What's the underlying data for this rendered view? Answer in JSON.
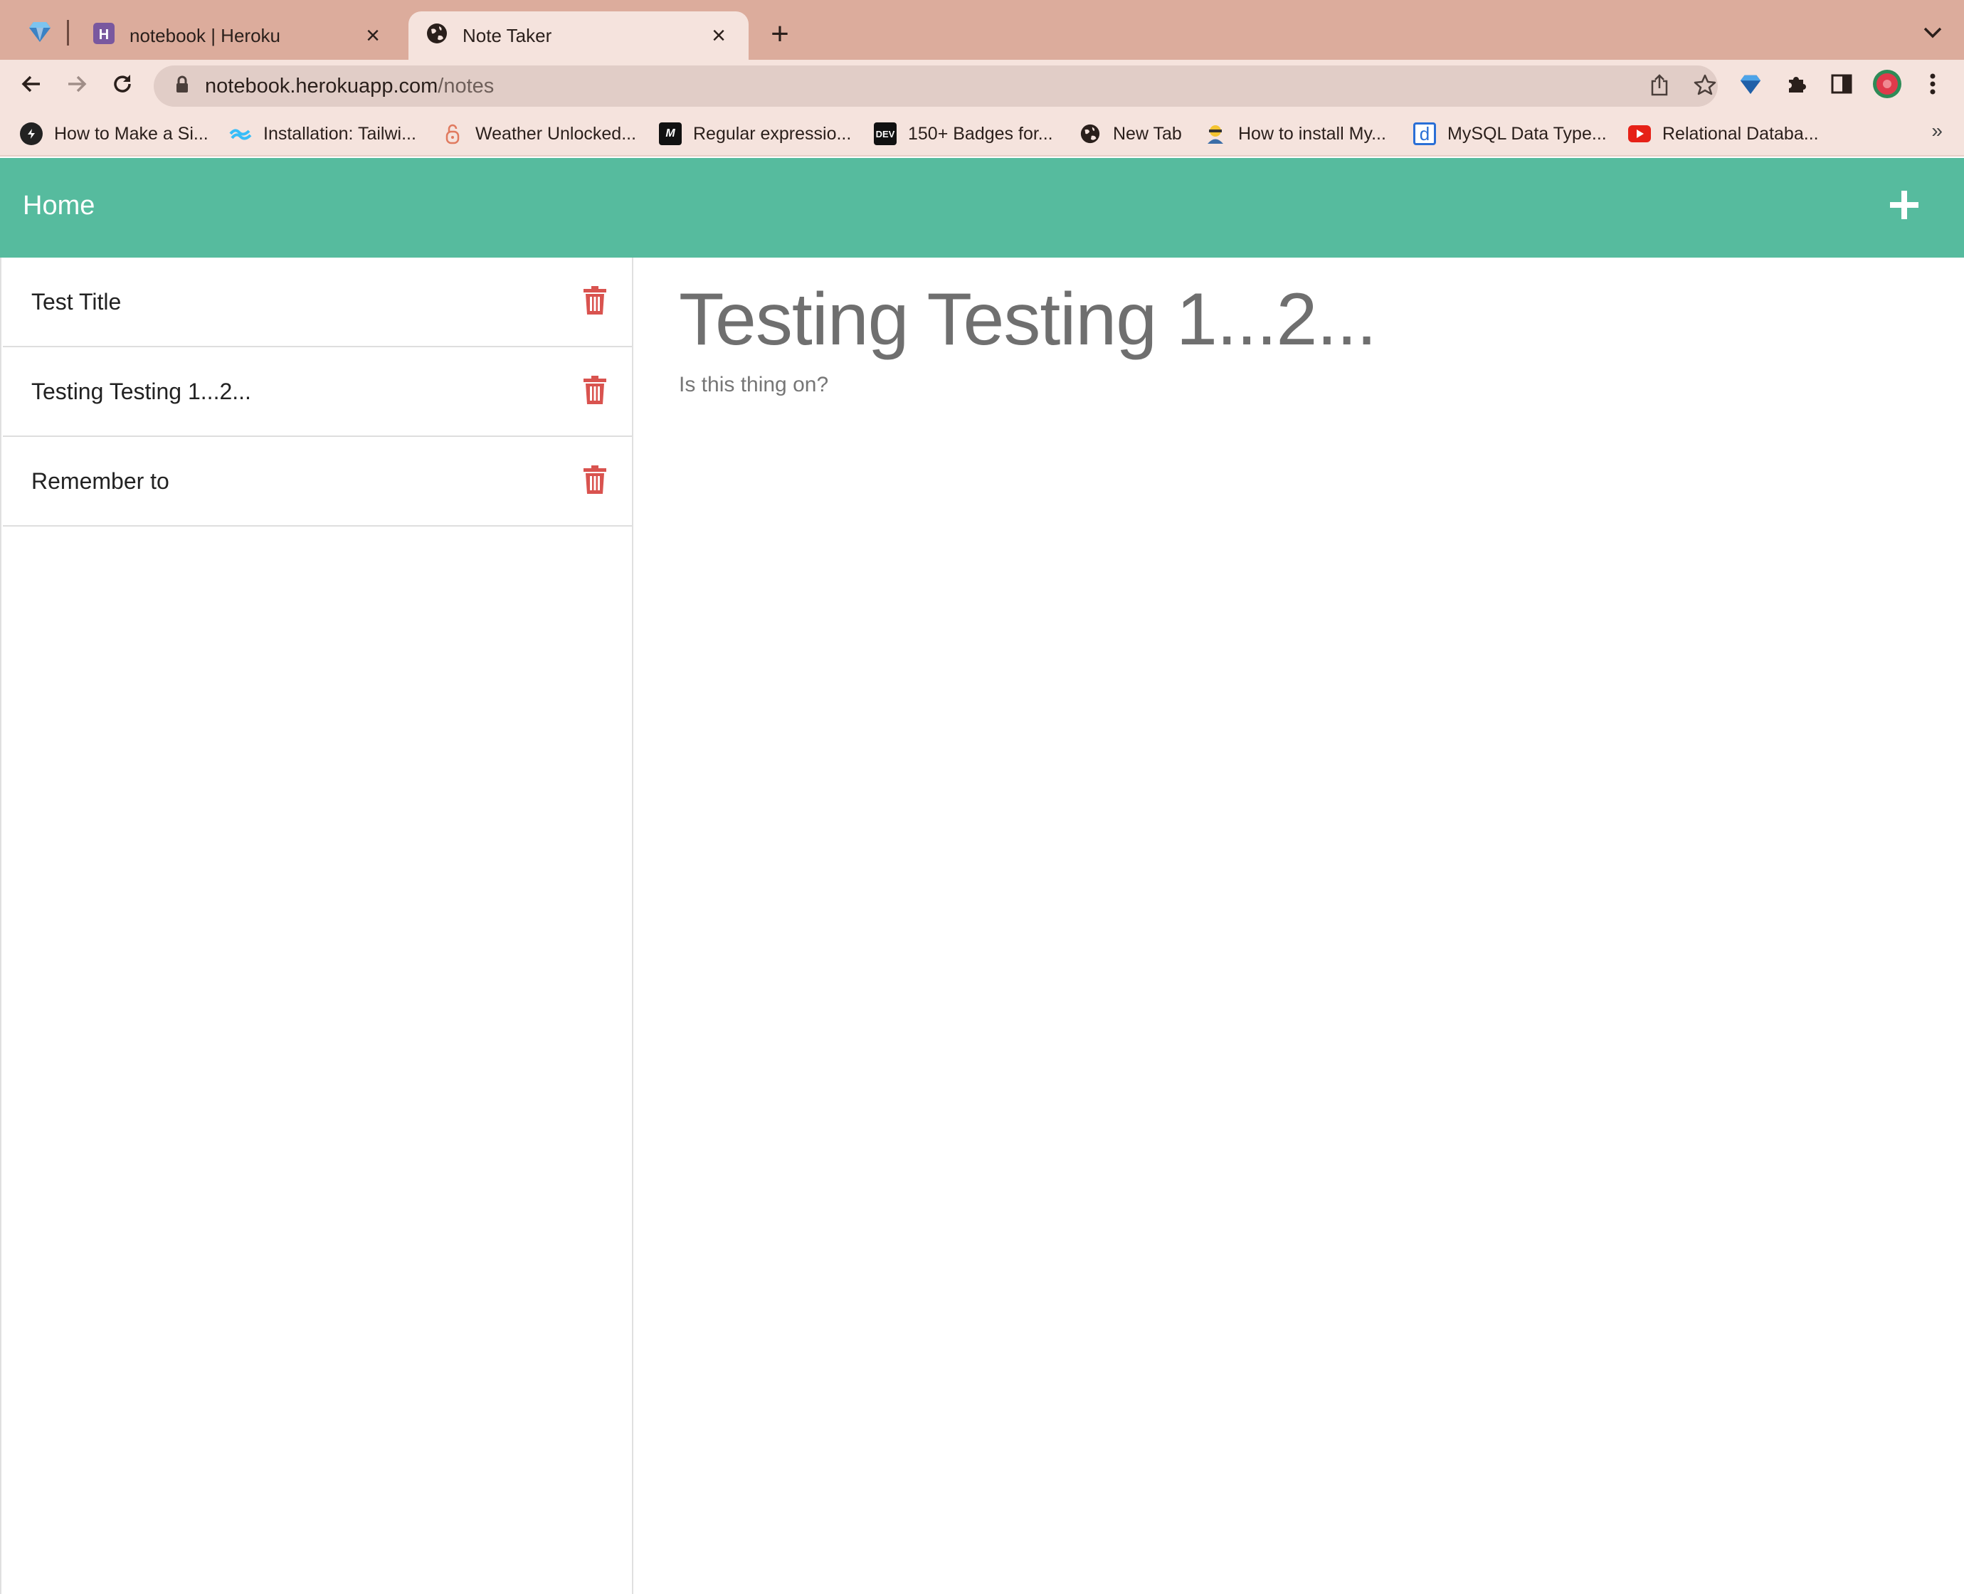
{
  "browser": {
    "tabs": [
      {
        "title": "notebook | Heroku",
        "active": false,
        "icon": "heroku-icon"
      },
      {
        "title": "Note Taker",
        "active": true,
        "icon": "globe-icon"
      }
    ],
    "address": {
      "host": "notebook.herokuapp.com",
      "path": "/notes"
    },
    "bookmarks": [
      {
        "label": "How to Make a Si...",
        "icon": "site-icon"
      },
      {
        "label": "Installation: Tailwi...",
        "icon": "tailwind-icon"
      },
      {
        "label": "Weather Unlocked...",
        "icon": "lock-icon"
      },
      {
        "label": "Regular expressio...",
        "icon": "mdn-icon"
      },
      {
        "label": "150+ Badges for...",
        "icon": "dev-icon"
      },
      {
        "label": "New Tab",
        "icon": "globe-icon"
      },
      {
        "label": "How to install My...",
        "icon": "user-icon"
      },
      {
        "label": "MySQL Data Type...",
        "icon": "d-icon"
      },
      {
        "label": "Relational Databa...",
        "icon": "youtube-icon"
      }
    ],
    "bookmark_glyphs": {
      "dev": "DEV",
      "mdn": "M",
      "d": "d"
    },
    "colors": {
      "tabstrip": "#dcac9c",
      "toolbar": "#f5e3dd"
    }
  },
  "app": {
    "navbar": {
      "home_label": "Home",
      "color": "#56bb9e"
    },
    "notes": [
      {
        "title": "Test Title"
      },
      {
        "title": "Testing Testing 1...2..."
      },
      {
        "title": "Remember to"
      }
    ],
    "active_note": {
      "title": "Testing Testing 1...2...",
      "body": "Is this thing on?"
    },
    "colors": {
      "delete": "#d9534f"
    }
  }
}
